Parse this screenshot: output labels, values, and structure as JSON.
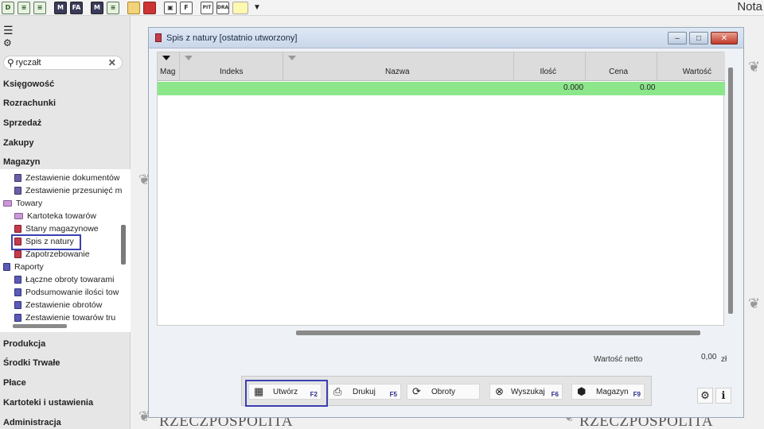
{
  "app_title": "Nota",
  "toolbar": {
    "buttons": [
      {
        "name": "doc-d-icon",
        "glyph": "D"
      },
      {
        "name": "doc-green-icon",
        "glyph": "≡"
      },
      {
        "name": "doc-green2-icon",
        "glyph": "≡"
      },
      {
        "name": "doc-m-icon",
        "glyph": "M"
      },
      {
        "name": "doc-fa-icon",
        "glyph": "FA"
      },
      {
        "name": "doc-m2-icon",
        "glyph": "M"
      },
      {
        "name": "doc-list-icon",
        "glyph": "≡"
      },
      {
        "name": "folder-icon",
        "glyph": ""
      },
      {
        "name": "red-doc-icon",
        "glyph": ""
      },
      {
        "name": "doc-image-icon",
        "glyph": "▣"
      },
      {
        "name": "doc-f-icon",
        "glyph": "F"
      },
      {
        "name": "doc-pit-icon",
        "glyph": "PIT"
      },
      {
        "name": "doc-dra-icon",
        "glyph": "DRA"
      },
      {
        "name": "note-icon",
        "glyph": ""
      }
    ],
    "dropdown": "▼"
  },
  "sidebar": {
    "search_value": "ryczałt",
    "sections_top": [
      "Księgowość",
      "Rozrachunki",
      "Sprzedaż",
      "Zakupy",
      "Magazyn"
    ],
    "tree": [
      {
        "label": "Zestawienie dokumentów",
        "icon": "doc",
        "indent": 1
      },
      {
        "label": "Zestawienie przesunięć m",
        "icon": "doc",
        "indent": 1
      },
      {
        "label": "Towary",
        "icon": "folder",
        "indent": 0
      },
      {
        "label": "Kartoteka towarów",
        "icon": "folder",
        "indent": 1
      },
      {
        "label": "Stany magazynowe",
        "icon": "red",
        "indent": 1
      },
      {
        "label": "Spis z natury",
        "icon": "red",
        "indent": 1
      },
      {
        "label": "Zapotrzebowanie",
        "icon": "red",
        "indent": 1
      },
      {
        "label": "Raporty",
        "icon": "report",
        "indent": 0
      },
      {
        "label": "Łączne obroty towarami",
        "icon": "report",
        "indent": 1
      },
      {
        "label": "Podsumowanie ilości tow",
        "icon": "report",
        "indent": 1
      },
      {
        "label": "Zestawienie obrotów",
        "icon": "report",
        "indent": 1
      },
      {
        "label": "Zestawienie towarów tru",
        "icon": "report",
        "indent": 1
      }
    ],
    "sections_bottom": [
      "Produkcja",
      "Środki Trwałe",
      "Płace",
      "Kartoteki i ustawienia",
      "Administracja"
    ]
  },
  "watermark": "RZECZPOSPOLITA",
  "window": {
    "title": "Spis z natury [ostatnio utworzony]",
    "columns": [
      "Mag",
      "Indeks",
      "Nazwa",
      "Ilość",
      "Cena",
      "Wartość"
    ],
    "row": {
      "ilosc": "0.000",
      "cena": "0.00",
      "wartosc": ""
    },
    "netto_label": "Wartość netto",
    "netto_value": "0,00",
    "netto_currency": "zł",
    "buttons": [
      {
        "label": "Utwórz",
        "key": "F2",
        "icon": "▦"
      },
      {
        "label": "Drukuj",
        "key": "F5",
        "icon": "⎙"
      },
      {
        "label": "Obroty",
        "key": "",
        "icon": "⟳"
      },
      {
        "label": "Wyszukaj",
        "key": "F6",
        "icon": "⊗"
      },
      {
        "label": "Magazyn",
        "key": "F9",
        "icon": "⬢"
      }
    ]
  }
}
